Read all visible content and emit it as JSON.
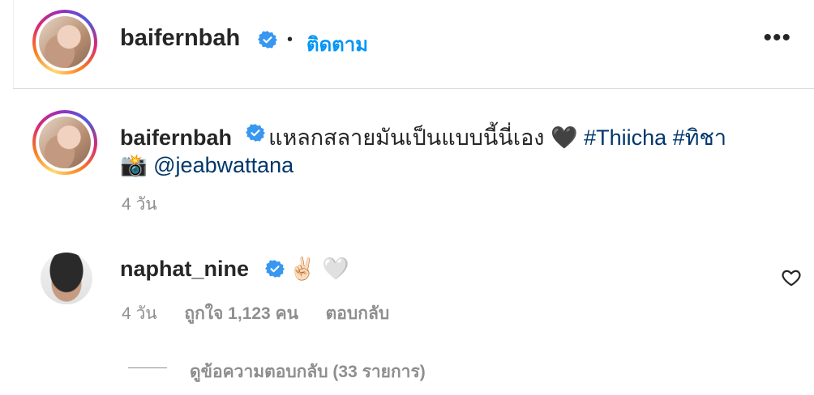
{
  "post_header": {
    "username": "baifernbah",
    "separator": "•",
    "follow_label": "ติดตาม",
    "more_icon": "more-horizontal-icon"
  },
  "caption": {
    "username": "baifernbah",
    "text": "แหลกสลายมันเป็นแบบนี้นี่เอง",
    "emoji_heart": "🖤",
    "hashtag_1": "#Thiicha",
    "hashtag_2": "#ทิชา",
    "emoji_camera": "📸",
    "mention": "@jeabwattana",
    "time": "4 วัน"
  },
  "comment": {
    "username": "naphat_nine",
    "emoji": "✌🏻 🤍",
    "time": "4 วัน",
    "likes": "ถูกใจ 1,123 คน",
    "reply_label": "ตอบกลับ",
    "view_replies": "ดูข้อความตอบกลับ (33 รายการ)"
  },
  "colors": {
    "link_blue": "#0095f6",
    "hashtag_blue": "#00376b",
    "verified_blue": "#3897f0",
    "secondary_text": "#8e8e8e"
  }
}
